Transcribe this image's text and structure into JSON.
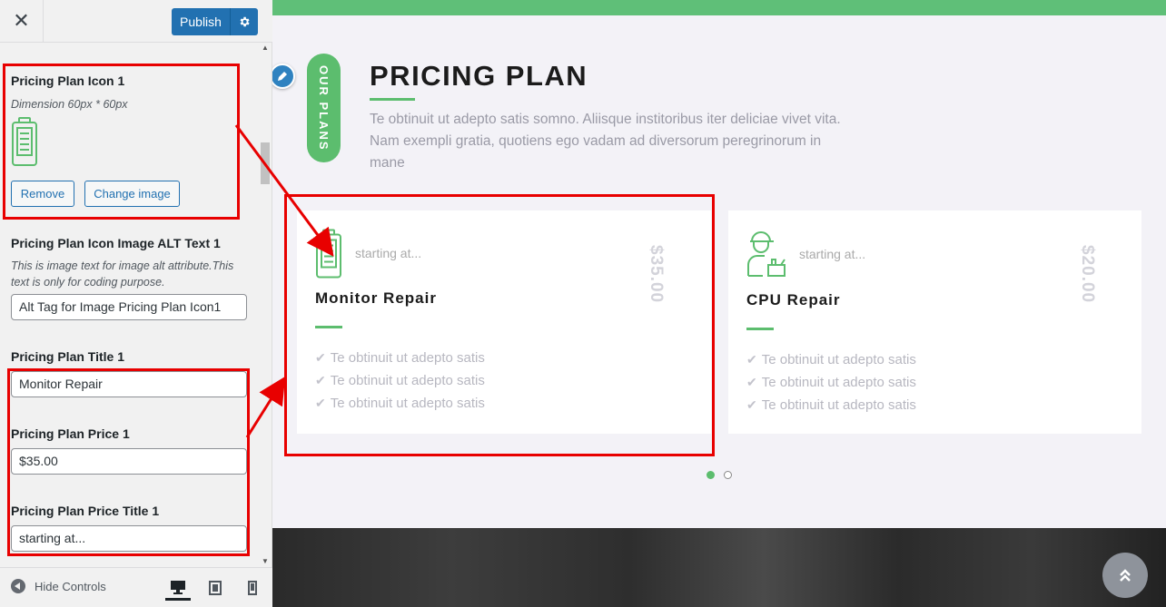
{
  "header": {
    "close_glyph": "✕",
    "publish_label": "Publish"
  },
  "sidebar": {
    "icon_section": {
      "label": "Pricing Plan Icon 1",
      "description": "Dimension 60px * 60px",
      "remove_label": "Remove",
      "change_label": "Change image"
    },
    "alt_section": {
      "label": "Pricing Plan Icon Image ALT Text 1",
      "description": "This is image text for image alt attribute.This text is only for coding purpose.",
      "value": "Alt Tag for Image Pricing Plan Icon1"
    },
    "title_section": {
      "label": "Pricing Plan Title 1",
      "value": "Monitor Repair"
    },
    "price_section": {
      "label": "Pricing Plan Price 1",
      "value": "$35.00"
    },
    "price_title_section": {
      "label": "Pricing Plan Price Title 1",
      "value": "starting at..."
    }
  },
  "footer": {
    "hide_controls_label": "Hide Controls"
  },
  "preview": {
    "badge": "OUR PLANS",
    "title": "PRICING PLAN",
    "description": "Te obtinuit ut adepto satis somno. Aliisque institoribus iter deliciae vivet vita. Nam exempli gratia, quotiens ego vadam ad diversorum peregrinorum in mane",
    "cards": [
      {
        "starting": "starting at...",
        "title": "Monitor Repair",
        "price": "$35.00",
        "features": [
          "Te obtinuit ut adepto satis",
          "Te obtinuit ut adepto satis",
          "Te obtinuit ut adepto satis"
        ]
      },
      {
        "starting": "starting at...",
        "title": "CPU Repair",
        "price": "$20.00",
        "features": [
          "Te obtinuit ut adepto satis",
          "Te obtinuit ut adepto satis",
          "Te obtinuit ut adepto satis"
        ]
      }
    ],
    "carousel": {
      "pages": 2,
      "active": 1
    }
  },
  "colors": {
    "accent_green": "#5cbd6e",
    "publish_blue": "#2271b1",
    "highlight_red": "#e80000"
  },
  "icons": [
    "close-icon",
    "gear-icon",
    "battery-icon",
    "technician-icon",
    "pencil-icon",
    "check-icon",
    "desktop-icon",
    "tablet-icon",
    "mobile-icon",
    "chevron-up-icon"
  ]
}
